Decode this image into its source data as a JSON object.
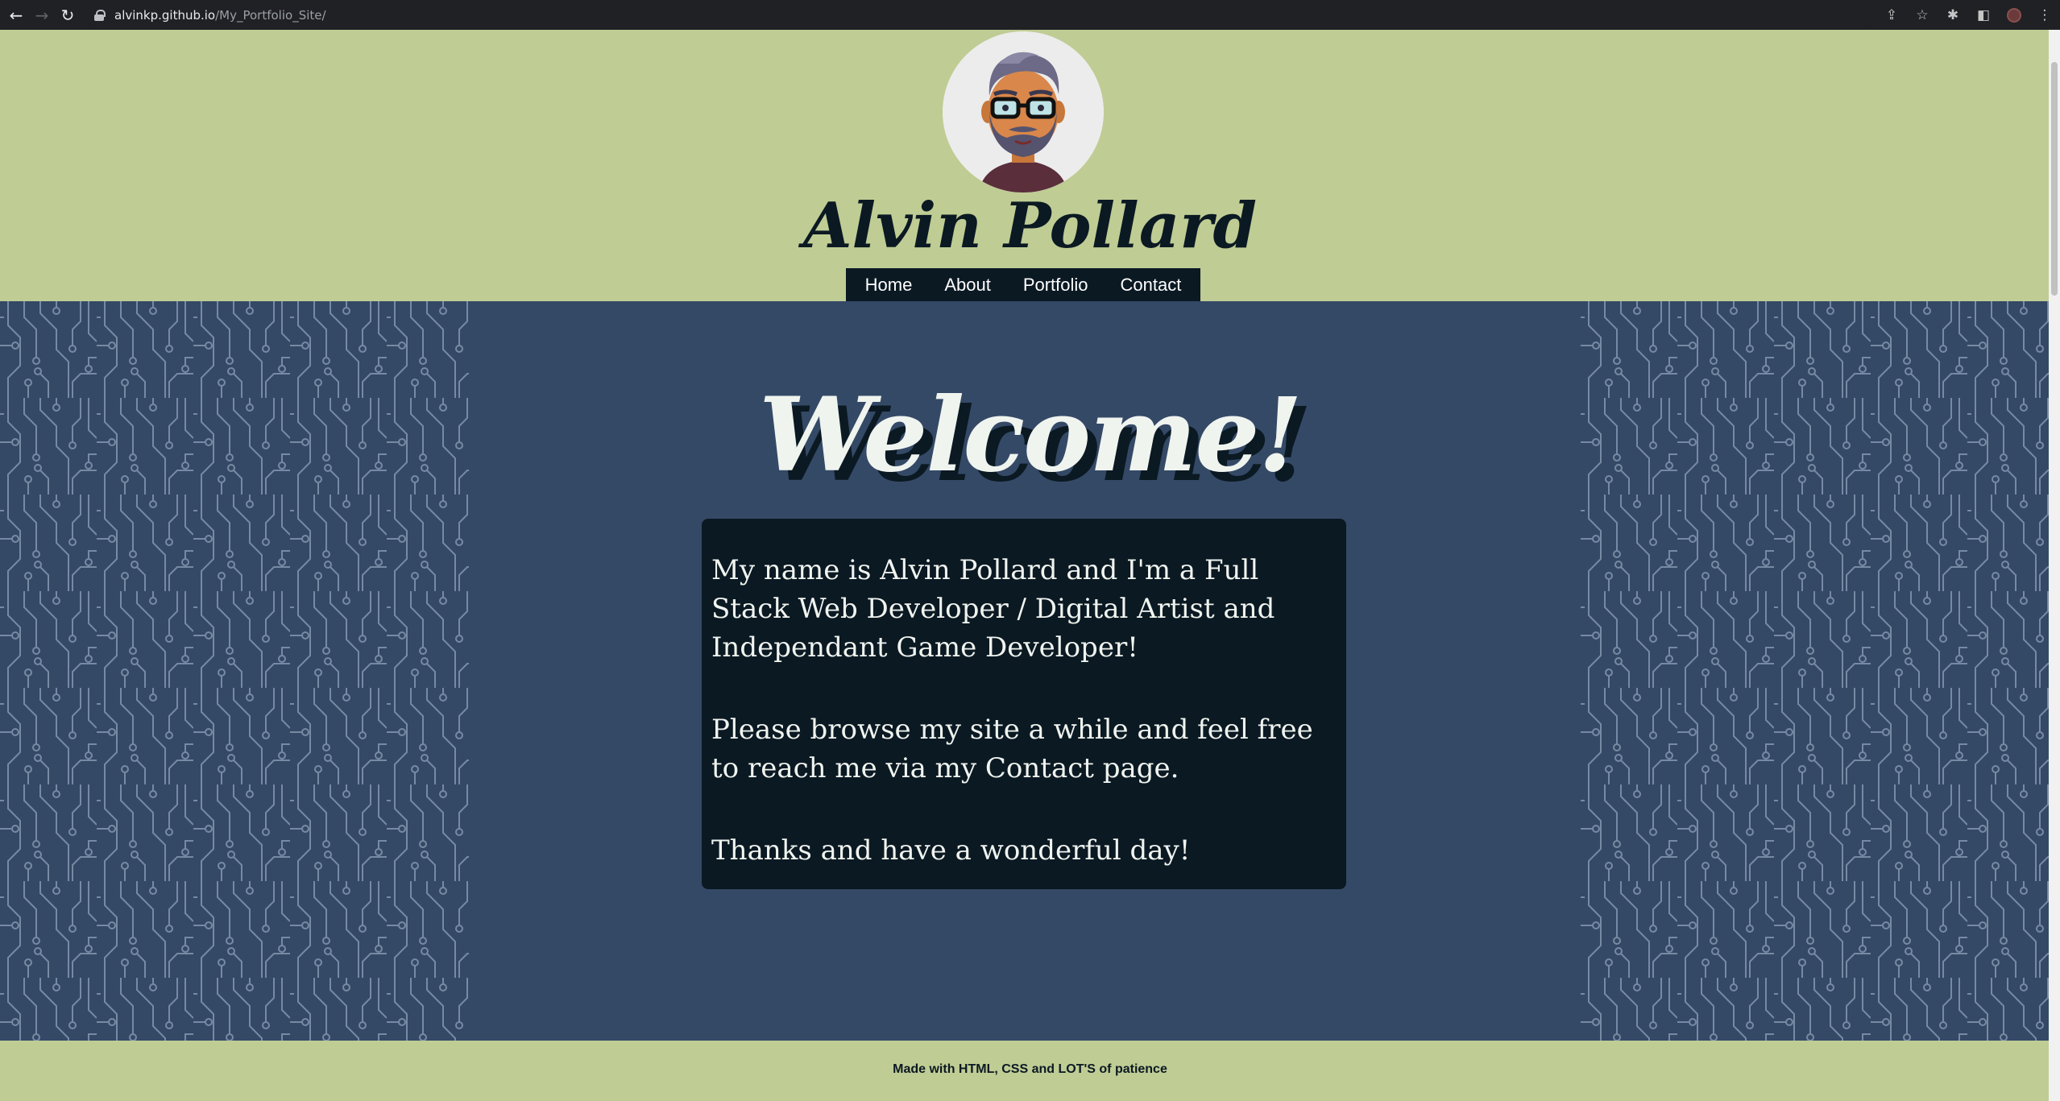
{
  "browser": {
    "url_host": "alvinkp.github.io",
    "url_path": "/My_Portfolio_Site/",
    "icons": [
      "back-icon",
      "forward-icon",
      "reload-icon",
      "lock-icon",
      "share-icon",
      "star-icon",
      "extensions-icon",
      "side-panel-icon",
      "profile-icon",
      "menu-icon"
    ]
  },
  "header": {
    "title": "Alvin Pollard",
    "nav": [
      {
        "label": "Home"
      },
      {
        "label": "About"
      },
      {
        "label": "Portfolio"
      },
      {
        "label": "Contact"
      }
    ]
  },
  "main": {
    "heading": "Welcome!",
    "paragraphs": [
      "My name is Alvin Pollard and I'm a Full Stack Web Developer / Digital Artist and Independant Game Developer!",
      "Please browse my site a while and feel free to reach me via my Contact page.",
      "Thanks and have a wonderful day!"
    ]
  },
  "footer": {
    "text": "Made with HTML, CSS and LOT'S of patience"
  },
  "colors": {
    "header_bg": "#bfcc94",
    "main_bg": "#344966",
    "dark": "#0b1923",
    "light_text": "#f0f4ef",
    "pattern_line": "#8da0b8"
  }
}
